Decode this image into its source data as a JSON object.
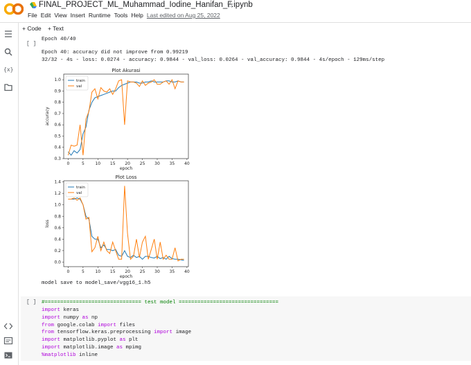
{
  "header": {
    "title": "FINAL_PROJECT_ML_Muhammad_Iodine_Hanifan_F.ipynb",
    "menu": [
      "File",
      "Edit",
      "View",
      "Insert",
      "Runtime",
      "Tools",
      "Help"
    ],
    "last_edited": "Last edited on Aug 25, 2022",
    "logo_text": "CO"
  },
  "toolbar": {
    "code_label": "+ Code",
    "text_label": "+ Text"
  },
  "sidebar": {
    "icons": [
      "toc-icon",
      "search-icon",
      "variables-icon",
      "files-icon",
      "code-snippets-icon",
      "command-palette-icon",
      "terminal-icon"
    ],
    "variables_label": "{x}"
  },
  "cell1": {
    "bracket": "[ ]",
    "epoch_line": "Epoch 40/40",
    "log_line1": "Epoch 40: accuracy did not improve from 0.99219",
    "log_line2": "32/32 - 4s - loss: 0.0274 - accuracy: 0.9844 - val_loss: 0.0264 - val_accuracy: 0.9844 - 4s/epoch - 129ms/step",
    "save_line": "model save to model_save/vgg16_1.h5"
  },
  "cell2": {
    "bracket": "[ ]",
    "comment": "#=============================== test model ================================",
    "lines": [
      {
        "kw": "import",
        "rest": " keras",
        "kw2": "",
        "rest2": ""
      },
      {
        "kw": "import",
        "rest": " numpy ",
        "kw2": "as",
        "rest2": " np"
      },
      {
        "kw": "from",
        "rest": " google.colab ",
        "kw2": "import",
        "rest2": " files"
      },
      {
        "kw": "from",
        "rest": " tensorflow.keras.preprocessing ",
        "kw2": "import",
        "rest2": " image"
      },
      {
        "kw": "import",
        "rest": " matplotlib.pyplot ",
        "kw2": "as",
        "rest2": " plt"
      },
      {
        "kw": "import",
        "rest": " matplotlib.image ",
        "kw2": "as",
        "rest2": " mpimg"
      },
      {
        "kw": "%matplotlib",
        "rest": " inline",
        "kw2": "",
        "rest2": ""
      }
    ]
  },
  "colors": {
    "train": "#1f77b4",
    "val": "#ff7f0e",
    "keyword": "#af00db",
    "comment": "#008000"
  },
  "chart_data": [
    {
      "type": "line",
      "title": "Plot Akurasi",
      "xlabel": "epoch",
      "ylabel": "accuracy",
      "legend_position": "top-left",
      "xlim": [
        -1.5,
        40.5
      ],
      "ylim": [
        0.3,
        1.05
      ],
      "xticks": [
        "0",
        "5",
        "10",
        "15",
        "20",
        "25",
        "30",
        "35",
        "40"
      ],
      "yticks": [
        "0.3",
        "0.4",
        "0.5",
        "0.6",
        "0.7",
        "0.8",
        "0.9",
        "1.0"
      ],
      "series": [
        {
          "name": "train",
          "color": "#1f77b4",
          "values": [
            0.36,
            0.33,
            0.37,
            0.35,
            0.38,
            0.52,
            0.58,
            0.73,
            0.8,
            0.84,
            0.85,
            0.86,
            0.87,
            0.88,
            0.89,
            0.9,
            0.9,
            0.93,
            0.95,
            0.96,
            0.97,
            0.98,
            0.98,
            0.98,
            0.97,
            0.97,
            0.98,
            0.98,
            0.99,
            0.98,
            0.98,
            0.98,
            0.98,
            0.99,
            0.99,
            0.98,
            0.98,
            0.99,
            0.98,
            0.98
          ]
        },
        {
          "name": "val",
          "color": "#ff7f0e",
          "values": [
            0.33,
            0.42,
            0.41,
            0.42,
            0.6,
            0.33,
            0.65,
            0.72,
            0.89,
            0.92,
            0.83,
            0.93,
            0.9,
            0.89,
            0.92,
            0.87,
            0.92,
            0.99,
            1.0,
            0.6,
            0.99,
            0.98,
            0.98,
            0.97,
            0.94,
            0.99,
            0.95,
            0.97,
            0.98,
            1.0,
            0.96,
            0.96,
            0.98,
            0.99,
            0.96,
            1.0,
            0.92,
            0.99,
            0.98,
            0.98
          ]
        }
      ]
    },
    {
      "type": "line",
      "title": "Plot Loss",
      "xlabel": "epoch",
      "ylabel": "loss",
      "legend_position": "top-left",
      "xlim": [
        -1.5,
        40.5
      ],
      "ylim": [
        -0.08,
        1.42
      ],
      "xticks": [
        "0",
        "5",
        "10",
        "15",
        "20",
        "25",
        "30",
        "35",
        "40"
      ],
      "yticks": [
        "0.0",
        "0.2",
        "0.4",
        "0.6",
        "0.8",
        "1.0",
        "1.2",
        "1.4"
      ],
      "series": [
        {
          "name": "train",
          "color": "#1f77b4",
          "values": [
            1.1,
            1.1,
            1.1,
            1.12,
            1.1,
            1.0,
            0.8,
            0.75,
            0.45,
            0.4,
            0.4,
            0.25,
            0.3,
            0.22,
            0.22,
            0.2,
            0.22,
            0.12,
            0.1,
            0.2,
            0.1,
            0.08,
            0.12,
            0.08,
            0.1,
            0.05,
            0.1,
            0.1,
            0.08,
            0.07,
            0.1,
            0.06,
            0.08,
            0.05,
            0.1,
            0.06,
            0.05,
            0.05,
            0.04,
            0.03
          ]
        },
        {
          "name": "val",
          "color": "#ff7f0e",
          "values": [
            1.1,
            1.1,
            1.12,
            1.08,
            1.12,
            1.0,
            0.75,
            0.78,
            0.18,
            0.25,
            0.45,
            0.2,
            0.35,
            0.2,
            0.15,
            0.35,
            0.2,
            0.05,
            0.05,
            1.33,
            0.5,
            0.05,
            0.1,
            0.4,
            0.08,
            0.35,
            0.45,
            0.05,
            0.22,
            0.4,
            0.05,
            0.35,
            0.05,
            0.12,
            0.05,
            0.05,
            0.25,
            0.02,
            0.05,
            0.05
          ]
        }
      ]
    }
  ]
}
